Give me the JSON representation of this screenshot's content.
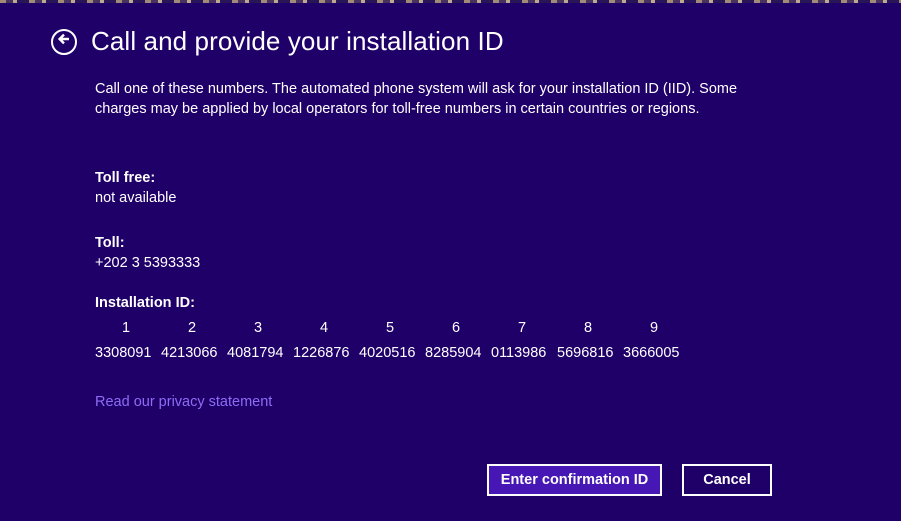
{
  "header": {
    "title": "Call and provide your installation ID",
    "back_icon": "arrow-left-circle-icon"
  },
  "description": "Call one of these numbers. The automated phone system will ask for your installation ID (IID). Some charges may be applied by local operators for toll-free numbers in certain countries or regions.",
  "toll_free": {
    "label": "Toll free:",
    "value": "not available"
  },
  "toll": {
    "label": "Toll:",
    "value": "+202 3 5393333"
  },
  "installation_id": {
    "label": "Installation ID:",
    "columns": [
      "1",
      "2",
      "3",
      "4",
      "5",
      "6",
      "7",
      "8",
      "9"
    ],
    "groups": [
      "3308091",
      "4213066",
      "4081794",
      "1226876",
      "4020516",
      "8285904",
      "0113986",
      "5696816",
      "3666005"
    ]
  },
  "privacy_link": "Read our privacy statement",
  "buttons": {
    "confirm": "Enter confirmation ID",
    "cancel": "Cancel"
  },
  "colors": {
    "background": "#1f0068",
    "primary_button": "#4617b4",
    "link": "#8d6cf6",
    "text": "#ffffff"
  }
}
